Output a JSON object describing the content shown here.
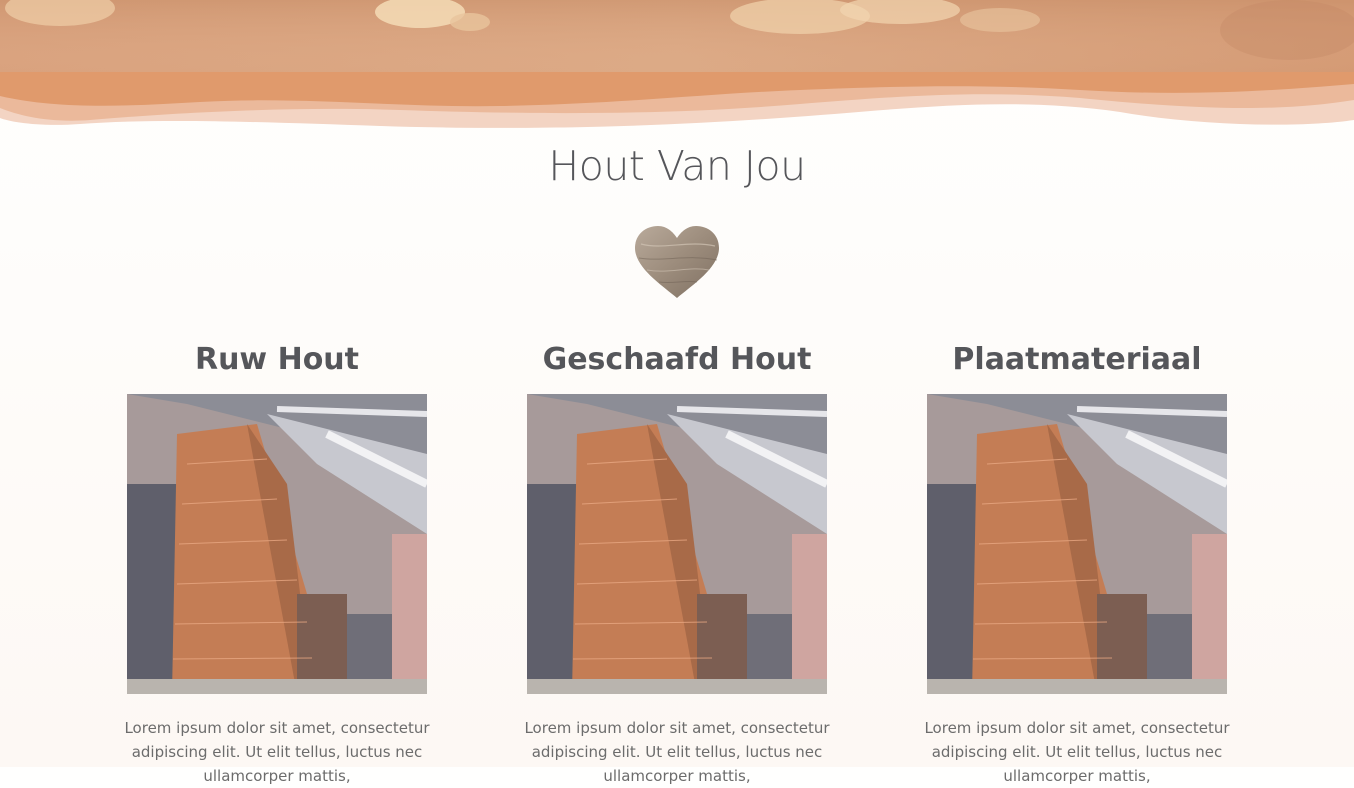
{
  "hero": {
    "image": "sawdust-wood-shavings-banner"
  },
  "page": {
    "title": "Hout Van Jou"
  },
  "heart": {
    "icon": "wooden-heart-icon"
  },
  "categories": [
    {
      "title": "Ruw Hout",
      "image": "lumber-warehouse-photo",
      "text": "Lorem ipsum dolor sit amet, consectetur adipiscing elit. Ut elit tellus, luctus nec ullamcorper mattis,"
    },
    {
      "title": "Geschaafd Hout",
      "image": "lumber-warehouse-photo",
      "text": "Lorem ipsum dolor sit amet, consectetur adipiscing elit. Ut elit tellus, luctus nec ullamcorper mattis,"
    },
    {
      "title": "Plaatmateriaal",
      "image": "lumber-warehouse-photo",
      "text": "Lorem ipsum dolor sit amet, consectetur adipiscing elit. Ut elit tellus, luctus nec ullamcorper mattis,"
    }
  ],
  "colors": {
    "accent": "#e09a6c",
    "heading": "#55565a",
    "body_text": "#6c6c6c"
  }
}
